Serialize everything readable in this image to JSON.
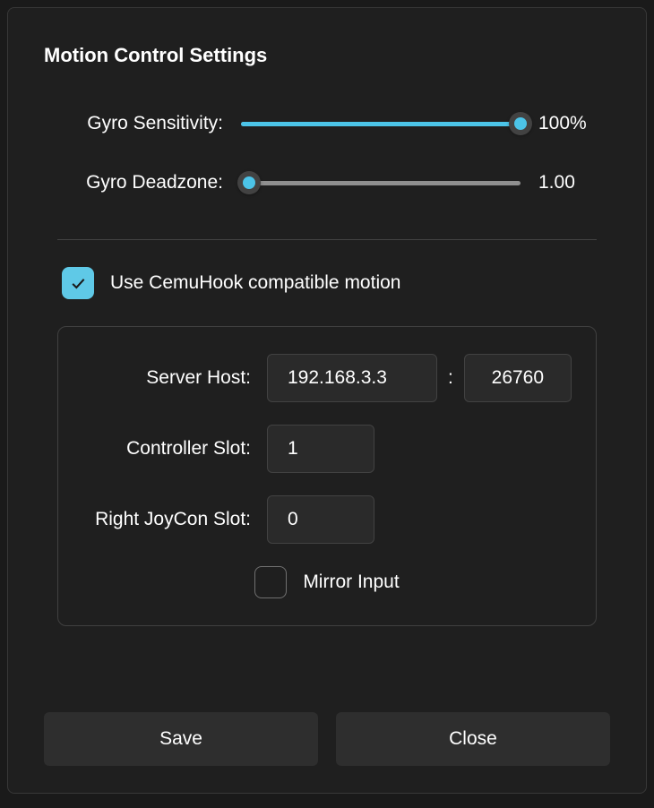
{
  "title": "Motion Control Settings",
  "sliders": {
    "sensitivity": {
      "label": "Gyro Sensitivity:",
      "value": "100%",
      "percent": 100
    },
    "deadzone": {
      "label": "Gyro Deadzone:",
      "value": "1.00",
      "percent": 0
    }
  },
  "cemuhook": {
    "label": "Use CemuHook compatible motion",
    "checked": true
  },
  "server": {
    "host_label": "Server Host:",
    "host_value": "192.168.3.3",
    "port_value": "26760",
    "controller_slot_label": "Controller Slot:",
    "controller_slot_value": "1",
    "joycon_slot_label": "Right JoyCon Slot:",
    "joycon_slot_value": "0",
    "mirror_label": "Mirror Input",
    "mirror_checked": false
  },
  "buttons": {
    "save": "Save",
    "close": "Close"
  }
}
